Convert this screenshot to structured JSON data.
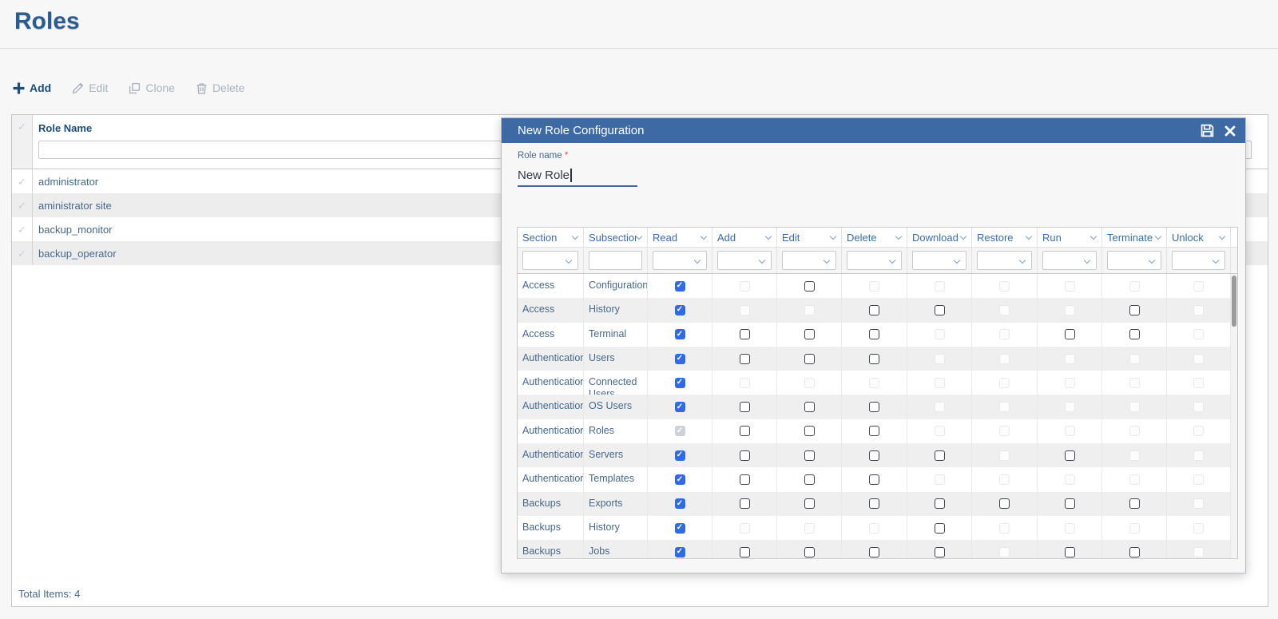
{
  "page": {
    "title": "Roles",
    "total_items_label": "Total Items: 4"
  },
  "toolbar": {
    "add_label": "Add",
    "edit_label": "Edit",
    "clone_label": "Clone",
    "delete_label": "Delete"
  },
  "roles_table": {
    "header": "Role Name",
    "filter_value": "",
    "rows": [
      {
        "name": "administrator"
      },
      {
        "name": "aministrator site"
      },
      {
        "name": "backup_monitor"
      },
      {
        "name": "backup_operator"
      }
    ]
  },
  "dialog": {
    "title": "New Role Configuration",
    "role_name": {
      "label": "Role name",
      "required_marker": "*",
      "value": "New Role"
    },
    "table": {
      "columns": [
        {
          "label": "Section",
          "filter": "select"
        },
        {
          "label": "Subsection ..",
          "filter": "text"
        },
        {
          "label": "Read",
          "filter": "select"
        },
        {
          "label": "Add",
          "filter": "select"
        },
        {
          "label": "Edit",
          "filter": "select"
        },
        {
          "label": "Delete",
          "filter": "select"
        },
        {
          "label": "Download ..",
          "filter": "select"
        },
        {
          "label": "Restore",
          "filter": "select"
        },
        {
          "label": "Run",
          "filter": "select"
        },
        {
          "label": "Terminate ..",
          "filter": "select"
        },
        {
          "label": "Unlock",
          "filter": "select"
        }
      ],
      "perm_keys": [
        "read",
        "add",
        "edit",
        "delete",
        "download",
        "restore",
        "run",
        "terminate",
        "unlock"
      ],
      "rows": [
        {
          "section": "Access",
          "subsection": "Configuration",
          "perms": [
            "checked",
            "disabled",
            "unchecked",
            "disabled",
            "disabled",
            "disabled",
            "disabled",
            "disabled",
            "disabled"
          ]
        },
        {
          "section": "Access",
          "subsection": "History",
          "perms": [
            "checked",
            "disabled",
            "disabled",
            "unchecked",
            "unchecked",
            "disabled",
            "disabled",
            "unchecked",
            "disabled"
          ]
        },
        {
          "section": "Access",
          "subsection": "Terminal",
          "perms": [
            "checked",
            "unchecked",
            "unchecked",
            "unchecked",
            "disabled",
            "disabled",
            "unchecked",
            "unchecked",
            "disabled"
          ]
        },
        {
          "section": "Authentication",
          "subsection": "Users",
          "perms": [
            "checked",
            "unchecked",
            "unchecked",
            "unchecked",
            "disabled",
            "disabled",
            "disabled",
            "disabled",
            "disabled"
          ]
        },
        {
          "section": "Authentication",
          "subsection": "Connected Users",
          "perms": [
            "checked",
            "disabled",
            "disabled",
            "disabled",
            "disabled",
            "disabled",
            "disabled",
            "disabled",
            "disabled"
          ]
        },
        {
          "section": "Authentication",
          "subsection": "OS Users",
          "perms": [
            "checked",
            "unchecked",
            "unchecked",
            "unchecked",
            "disabled",
            "disabled",
            "disabled",
            "disabled",
            "disabled"
          ]
        },
        {
          "section": "Authentication",
          "subsection": "Roles",
          "perms": [
            "checked-disabled",
            "unchecked",
            "unchecked",
            "unchecked",
            "disabled",
            "disabled",
            "disabled",
            "disabled",
            "disabled"
          ]
        },
        {
          "section": "Authentication",
          "subsection": "Servers",
          "perms": [
            "checked",
            "unchecked",
            "unchecked",
            "unchecked",
            "unchecked",
            "disabled",
            "unchecked",
            "disabled",
            "disabled"
          ]
        },
        {
          "section": "Authentication",
          "subsection": "Templates",
          "perms": [
            "checked",
            "unchecked",
            "unchecked",
            "unchecked",
            "disabled",
            "disabled",
            "disabled",
            "disabled",
            "disabled"
          ]
        },
        {
          "section": "Backups",
          "subsection": "Exports",
          "perms": [
            "checked",
            "unchecked",
            "unchecked",
            "unchecked",
            "unchecked",
            "unchecked",
            "unchecked",
            "unchecked",
            "disabled"
          ]
        },
        {
          "section": "Backups",
          "subsection": "History",
          "perms": [
            "checked",
            "disabled",
            "disabled",
            "disabled",
            "unchecked",
            "disabled",
            "disabled",
            "disabled",
            "disabled"
          ]
        },
        {
          "section": "Backups",
          "subsection": "Jobs",
          "perms": [
            "checked",
            "unchecked",
            "unchecked",
            "unchecked",
            "unchecked",
            "disabled",
            "unchecked",
            "unchecked",
            "disabled"
          ]
        }
      ]
    }
  },
  "icons": {
    "check": "✓",
    "row_check": "✓"
  },
  "colors": {
    "accent": "#3d6aa4",
    "title": "#2b5c8f",
    "link": "#1d4e79",
    "txt": "#47688c",
    "hdrtxt": "#3a6ca6",
    "disabled": "#a9b2be",
    "cb": "#2e6be5"
  }
}
